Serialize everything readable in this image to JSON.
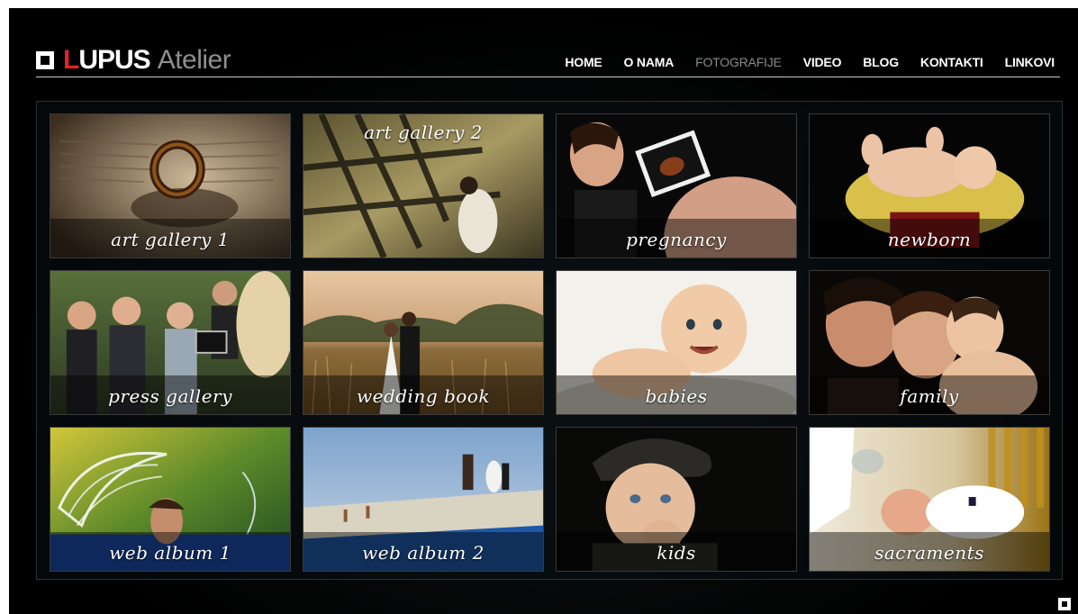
{
  "brand": {
    "letter_l": "L",
    "letters_upus": "UPUS",
    "atelier": "Atelier",
    "accent_color": "#e02424"
  },
  "nav": {
    "items": [
      {
        "label": "HOME",
        "active": false
      },
      {
        "label": "O NAMA",
        "active": false
      },
      {
        "label": "FOTOGRAFIJE",
        "active": true
      },
      {
        "label": "VIDEO",
        "active": false
      },
      {
        "label": "BLOG",
        "active": false
      },
      {
        "label": "KONTAKTI",
        "active": false
      },
      {
        "label": "LINKOVI",
        "active": false
      }
    ]
  },
  "gallery": {
    "tiles": [
      {
        "label": "art gallery 1"
      },
      {
        "label": "art gallery 2"
      },
      {
        "label": "pregnancy"
      },
      {
        "label": "newborn"
      },
      {
        "label": "press gallery"
      },
      {
        "label": "wedding book"
      },
      {
        "label": "babies"
      },
      {
        "label": "family"
      },
      {
        "label": "web album 1"
      },
      {
        "label": "web album 2"
      },
      {
        "label": "kids"
      },
      {
        "label": "sacraments"
      }
    ]
  }
}
